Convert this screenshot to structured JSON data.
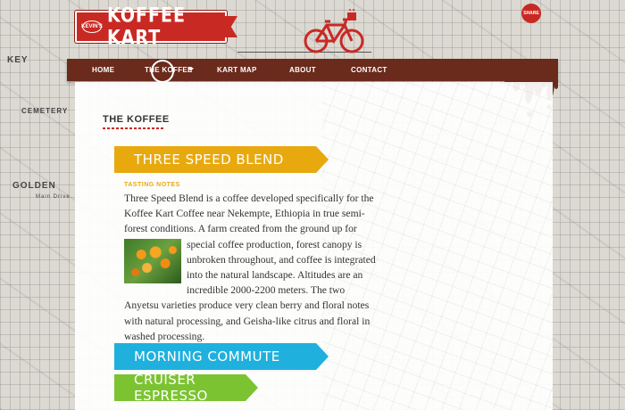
{
  "logo": {
    "prefix": "KEVIN'S",
    "name": "KOFFEE KART"
  },
  "share": {
    "label": "SHARE"
  },
  "nav": {
    "items": [
      {
        "label": "HOME"
      },
      {
        "label": "THE KOFFEE",
        "active": true
      },
      {
        "label": "KART MAP"
      },
      {
        "label": "ABOUT"
      },
      {
        "label": "CONTACT"
      }
    ]
  },
  "map": {
    "labels": [
      "KEY",
      "CEMETERY",
      "GOLDEN",
      "Main Drive"
    ]
  },
  "page": {
    "title": "THE KOFFEE"
  },
  "coffees": [
    {
      "name": "THREE SPEED BLEND",
      "color": "#e8a90e",
      "notes_label": "TASTING NOTES",
      "description_before_image": "Three Speed Blend is a coffee developed specifically for the Koffee Kart Coffee near Nekempte, Ethiopia in true semi-forest conditions. A farm created from the ground up for special coffee production, forest canopy is",
      "description_after_image": "unbroken throughout, and coffee is integrated into the natural landscape. Altitudes are an incredible 2000-2200 meters. The two Anyetsu varieties produce very clean berry and floral notes with natural processing, and Geisha-like citrus and floral in washed processing."
    },
    {
      "name": "MORNING COMMUTE",
      "color": "#1fb0de"
    },
    {
      "name": "CRUISER ESPRESSO",
      "color": "#7cc332"
    }
  ],
  "colors": {
    "brand_red": "#c82a23",
    "nav_brown": "#6a2a1c"
  }
}
